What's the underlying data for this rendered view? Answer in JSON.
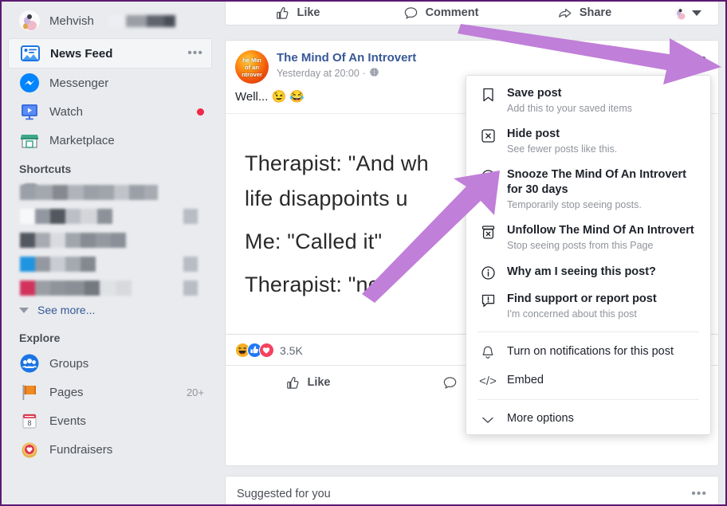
{
  "sidebar": {
    "profile": {
      "name": "Mehvish",
      "redacted": true
    },
    "nav": [
      {
        "label": "News Feed",
        "icon": "news-feed-icon",
        "active": true,
        "right": "more-dots"
      },
      {
        "label": "Messenger",
        "icon": "messenger-icon",
        "active": false,
        "right": ""
      },
      {
        "label": "Watch",
        "icon": "watch-icon",
        "active": false,
        "right": "red-dot"
      },
      {
        "label": "Marketplace",
        "icon": "marketplace-icon",
        "active": false,
        "right": ""
      }
    ],
    "shortcuts_title": "Shortcuts",
    "see_more": "See more...",
    "explore_title": "Explore",
    "explore": [
      {
        "label": "Groups",
        "icon": "groups-icon",
        "badge": ""
      },
      {
        "label": "Pages",
        "icon": "pages-flag-icon",
        "badge": "20+"
      },
      {
        "label": "Events",
        "icon": "events-calendar-icon",
        "badge": ""
      },
      {
        "label": "Fundraisers",
        "icon": "fundraisers-heart-icon",
        "badge": ""
      }
    ]
  },
  "top_post_actions": [
    {
      "label": "Like",
      "icon": "thumbs-up-icon"
    },
    {
      "label": "Comment",
      "icon": "comment-bubble-icon"
    },
    {
      "label": "Share",
      "icon": "share-arrow-icon"
    }
  ],
  "post": {
    "page_name": "The Mind Of An Introvert",
    "avatar_lines": [
      "he Min",
      "of an",
      "ntrover"
    ],
    "timestamp": "Yesterday at 20:00",
    "separator": "·",
    "privacy_icon": "globe-icon",
    "body_text": "Well... 😉 😂",
    "image_lines": [
      "Therapist: \"And wh",
      "life disappoints u",
      "Me: \"Called it\"",
      "Therapist: \"no\""
    ],
    "reaction_count": "3.5K",
    "reactions": [
      "haha",
      "like",
      "love"
    ],
    "footer_actions": [
      {
        "label": "Like",
        "icon": "thumbs-up-icon"
      },
      {
        "label": "Comm",
        "icon": "comment-bubble-icon"
      }
    ],
    "more_dots": "•••"
  },
  "menu": {
    "items": [
      {
        "title": "Save post",
        "sub": "Add this to your saved items",
        "icon": "bookmark-icon",
        "bold": true
      },
      {
        "title": "Hide post",
        "sub": "See fewer posts like this.",
        "icon": "hide-x-box-icon",
        "bold": true
      },
      {
        "title": "Snooze The Mind Of An Introvert for 30 days",
        "sub": "Temporarily stop seeing posts.",
        "icon": "clock-icon",
        "bold": true
      },
      {
        "title": "Unfollow The Mind Of An Introvert",
        "sub": "Stop seeing posts from this Page",
        "icon": "unfollow-icon",
        "bold": true
      },
      {
        "title": "Why am I seeing this post?",
        "sub": "",
        "icon": "info-circle-icon",
        "bold": true
      },
      {
        "title": "Find support or report post",
        "sub": "I'm concerned about this post",
        "icon": "report-flag-icon",
        "bold": true
      }
    ],
    "secondary": [
      {
        "title": "Turn on notifications for this post",
        "icon": "bell-icon"
      },
      {
        "title": "Embed",
        "icon": "code-embed-icon"
      }
    ],
    "more_options": {
      "title": "More options",
      "icon": "chevron-down-icon"
    }
  },
  "suggested": {
    "label": "Suggested for you",
    "more_dots": "•••"
  },
  "colors": {
    "annotation_arrow": "#c07fd8",
    "page_bg": "#e9ebee",
    "card_bg": "#ffffff",
    "link": "#385898",
    "border_frame": "#5b1a72",
    "watch_badge": "#f02849"
  }
}
